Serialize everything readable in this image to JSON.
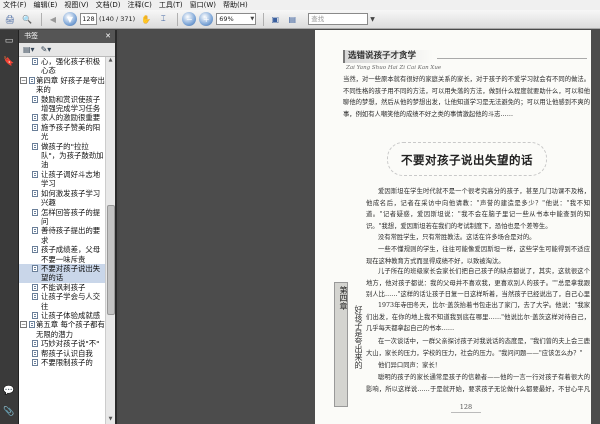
{
  "menu": [
    "文件(F)",
    "编辑(E)",
    "视图(V)",
    "文档(D)",
    "注释(C)",
    "工具(T)",
    "窗口(W)",
    "帮助(H)"
  ],
  "toolbar": {
    "current_page": "128",
    "page_total": "(140 / 371)",
    "zoom": "69%",
    "find_placeholder": "查找"
  },
  "bookmarks_panel": {
    "title": "书签",
    "items": [
      {
        "level": 1,
        "text": "心，强化孩子积极心态"
      },
      {
        "level": 0,
        "text": "第四章  好孩子是夸出来的"
      },
      {
        "level": 1,
        "text": "鼓励和赏识使孩子增强完成学习任务"
      },
      {
        "level": 1,
        "text": "家人的激励很重要"
      },
      {
        "level": 1,
        "text": "施予孩子赞美的阳光"
      },
      {
        "level": 1,
        "text": "做孩子的\"拉拉队\"，为孩子鼓劲加油"
      },
      {
        "level": 1,
        "text": "让孩子调好斗志地学习"
      },
      {
        "level": 1,
        "text": "如何激发孩子学习兴趣"
      },
      {
        "level": 1,
        "text": "怎样回答孩子的提问"
      },
      {
        "level": 1,
        "text": "善待孩子提出的要求"
      },
      {
        "level": 1,
        "text": "孩子成绩差，父母不要一味斥责"
      },
      {
        "level": 1,
        "text": "不要对孩子说出失望的话",
        "selected": true
      },
      {
        "level": 1,
        "text": "不能讽刺孩子"
      },
      {
        "level": 1,
        "text": "让孩子学会与人交往"
      },
      {
        "level": 1,
        "text": "让孩子体验成就感"
      },
      {
        "level": 0,
        "text": "第五章  每个孩子都有无限的潜力"
      },
      {
        "level": 1,
        "text": "巧妙对孩子说\"不\""
      },
      {
        "level": 1,
        "text": "帮孩子认识自我"
      },
      {
        "level": 1,
        "text": "不要限制孩子的"
      }
    ]
  },
  "page": {
    "running_head": "选错说孩子才贪学",
    "running_head_sub": "Zai Yang Shuo Hai Zi Cai Kan Xue",
    "intro_paragraph": "当然，对一些原本就有很好的家庭关系的家长，对于孩子的不爱学习就会有不同的做法。不同性格的孩子用不同的方法，可以用失落的方法，做到什么程度就要助什么，可以和他聊他的梦想，然后从他的梦想出发，让他知道学习是无法避免的；可以用让他感到不爽的事，例如有人嘲笑他的成绩不好之类的事情激起他的斗志……",
    "chapter_title": "不要对孩子说出失望的话",
    "body_paragraphs": [
      "爱因斯坦在学生时代就不是一个很考究高分的孩子，甚至几门功课不及格，他成名后，记者在采访中向他请教：\"声誉的建造是多少？\"他说：\"我不知道。\"记者疑惑，爱因斯坦说：\"我不会在脑子里记一些从书本中能查到的知识。\"我想，爱因斯坦若在我们的考试制度下，恐怕也是个差等生。",
      "没有常胜学生，只有常胜教法。这话在许多场合是对的。",
      "一些不懂规则的学生，往往可能像爱因斯坦一样，这些学生可能得到不适应现在这种教育方式而显得成绩不好，以致被淘汰。",
      "儿子所在的班级家长会家长们把自己孩子的缺点都说了，其实，这就很这个地方，他对孩子都说：我的父母并不喜欢我，更喜欢别人的孩子。\"\"总是拿我跟别人比……\"这样的话让孩子日复一日这样听着，当然孩子已经说出了，自己心里不服气。许多孩子也说，父母一句一句话，一点也不留情，这些话加在一起伤害他的心。",
      "1973年寺田冬天，比尔·盖茨抬着书包走出了家门，去了大学。他说：\"我家们出发，在你的地上我不知道我到底在哪里……\"他说比尔·盖茨这样对待自己，几乎每天都拿起自己的书本……",
      "在一次谈话中，一群父亲探讨孩子对我说话的态度是，\"我们曾的夫上会三鹿大山，家长的压力，学校的压力，社会的压力。\"我问问题——\"应该怎么办？\"",
      "他们异口同声：家长！",
      "聪明的孩子的家长通常是孩子的信赖者——他的一言一行对孩子有着很大的影响，所以这样说……于是就开始，要求孩子无论做什么都要最好，不甘心平凡无奇。"
    ],
    "side_label": "第四章",
    "side_text": "好孩子是夸出来的",
    "page_number": "128"
  }
}
